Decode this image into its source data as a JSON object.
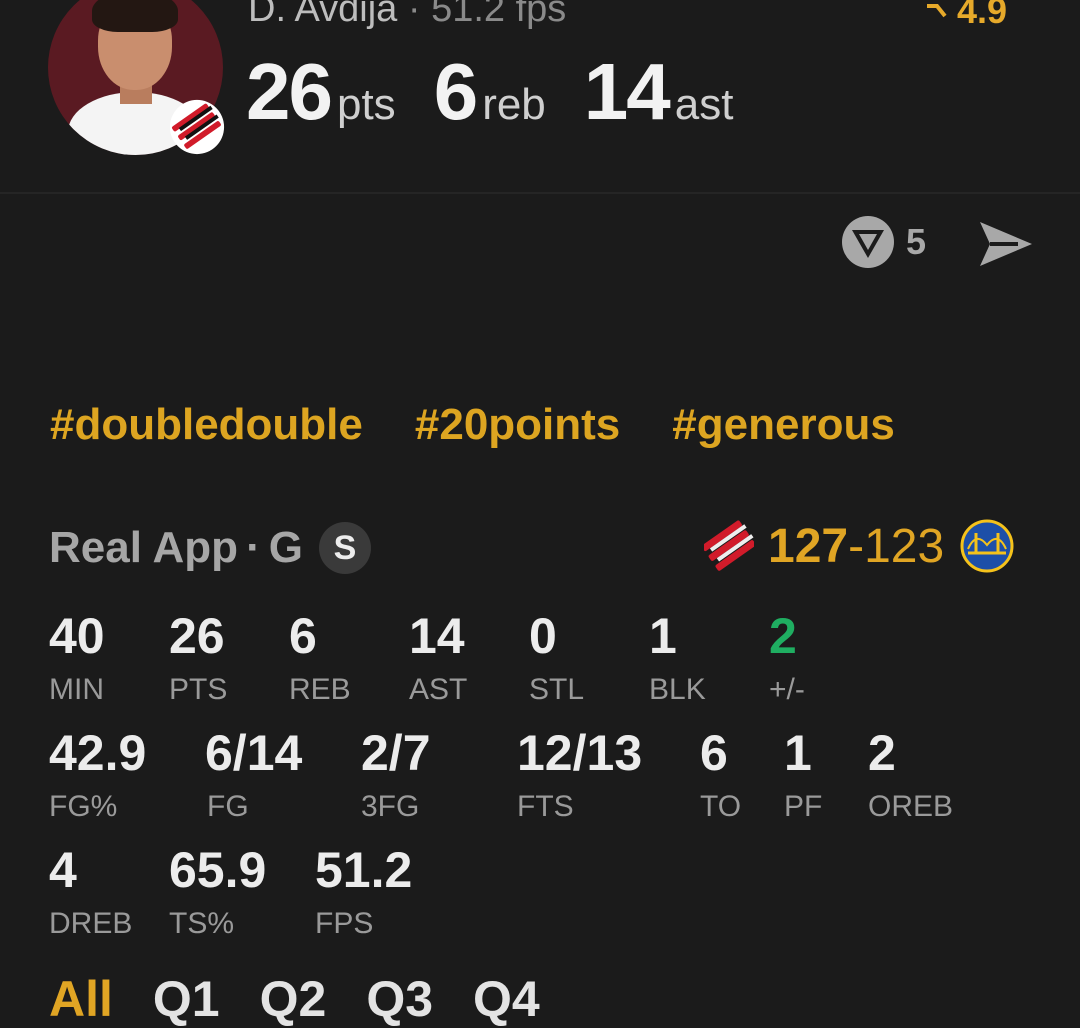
{
  "player": {
    "name": "D. Avdija",
    "fps_summary": "51.2 fps",
    "rating": "4.9",
    "headline": [
      {
        "value": "26",
        "unit": "pts"
      },
      {
        "value": "6",
        "unit": "reb"
      },
      {
        "value": "14",
        "unit": "ast"
      }
    ]
  },
  "actions": {
    "comment_count": "5"
  },
  "tags": [
    "#doubledouble",
    "#20points",
    "#generous"
  ],
  "box": {
    "source": "Real App",
    "position": "G",
    "badge": "S",
    "score_home": "127",
    "score_dash": "-",
    "score_away": "123"
  },
  "stats": {
    "min": {
      "value": "40",
      "label": "MIN"
    },
    "pts": {
      "value": "26",
      "label": "PTS"
    },
    "reb": {
      "value": "6",
      "label": "REB"
    },
    "ast": {
      "value": "14",
      "label": "AST"
    },
    "stl": {
      "value": "0",
      "label": "STL"
    },
    "blk": {
      "value": "1",
      "label": "BLK"
    },
    "pm": {
      "value": "2",
      "label": "+/-"
    },
    "fgp": {
      "value": "42.9",
      "label": "FG%"
    },
    "fg": {
      "value": "6/14",
      "label": "FG"
    },
    "tfg": {
      "value": "2/7",
      "label": "3FG"
    },
    "fts": {
      "value": "12/13",
      "label": "FTS"
    },
    "to": {
      "value": "6",
      "label": "TO"
    },
    "pf": {
      "value": "1",
      "label": "PF"
    },
    "oreb": {
      "value": "2",
      "label": "OREB"
    },
    "dreb": {
      "value": "4",
      "label": "DREB"
    },
    "tsp": {
      "value": "65.9",
      "label": "TS%"
    },
    "fps": {
      "value": "51.2",
      "label": "FPS"
    }
  },
  "quarters": [
    "All",
    "Q1",
    "Q2",
    "Q3",
    "Q4"
  ],
  "colors": {
    "accent": "#e0a524",
    "positive": "#1fae61",
    "background": "#1b1b1b"
  }
}
